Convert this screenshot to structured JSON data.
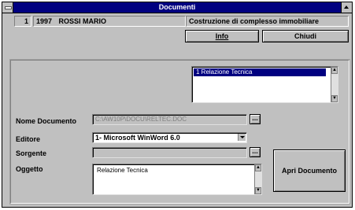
{
  "window": {
    "title": "Documenti"
  },
  "header": {
    "number": "1",
    "year": "1997",
    "client": "ROSSI MARIO",
    "project": "Costruzione di complesso immobiliare"
  },
  "buttons": {
    "info_label": "Info",
    "close_label": "Chiudi",
    "open_label": "Apri Documento"
  },
  "document_list": {
    "items": [
      {
        "label": "1  Relazione Tecnica"
      }
    ]
  },
  "form": {
    "nome_label": "Nome Documento",
    "nome_value": "C:\\AW10P\\DOCU\\RELTEC.DOC",
    "editore_label": "Editore",
    "editore_value": "1- Microsoft WinWord 6.0",
    "sorgente_label": "Sorgente",
    "sorgente_value": "",
    "oggetto_label": "Oggetto",
    "oggetto_value": "Relazione Tecnica",
    "browse_label": "..."
  },
  "icons": {
    "system_menu": "system-menu-icon",
    "maximize": "maximize-icon",
    "dropdown": "chevron-down-icon",
    "scroll_up": "scroll-up-icon",
    "scroll_down": "scroll-down-icon"
  },
  "colors": {
    "titlebar": "#000080",
    "window_bg": "#c0c0c0",
    "selection": "#000080"
  }
}
